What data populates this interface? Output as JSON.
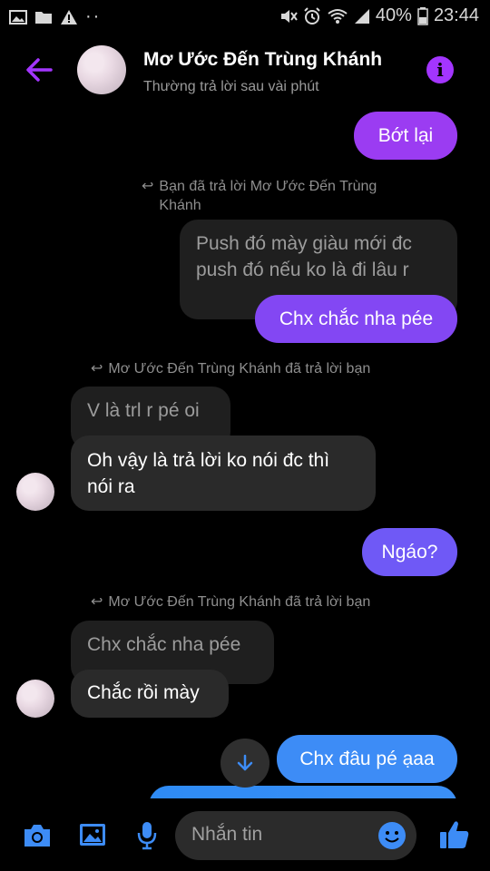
{
  "status": {
    "battery": "40%",
    "time": "23:44"
  },
  "header": {
    "contact_name": "Mơ Ước Đến Trùng Khánh",
    "subtitle": "Thường trả lời sau vài phút"
  },
  "messages": {
    "m1": "Bớt lại",
    "reply1": "Bạn đã trả lời Mơ Ước Đến Trùng Khánh",
    "quoted1": "Push đó mày giàu mới đc push đó nếu ko là đi lâu r",
    "m2": "Chx chắc nha pée",
    "reply2": "Mơ Ước Đến Trùng Khánh đã trả lời bạn",
    "quoted2": "V là trl r pé oi",
    "m3": "Oh vậy là trả lời ko nói đc thì nói ra",
    "m4": "Ngáo?",
    "reply3": "Mơ Ước Đến Trùng Khánh đã trả lời bạn",
    "quoted3": "Chx chắc nha pée",
    "m5": "Chắc rồi mày",
    "m6": "Chx đâu pé ạaa"
  },
  "composer": {
    "placeholder": "Nhắn tin"
  },
  "colors": {
    "accent": "#a335ff",
    "bubble_purple": "#9b3cf2",
    "bubble_violet": "#6f59f6",
    "bubble_blue": "#3d8cf6"
  }
}
